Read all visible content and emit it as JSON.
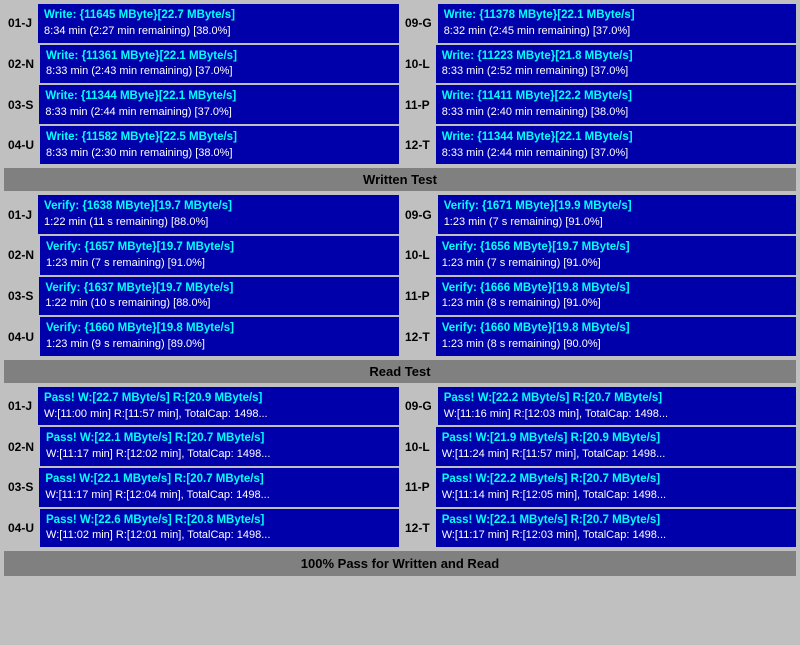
{
  "write_section": {
    "rows_left": [
      {
        "id": "01-J",
        "line1": "Write: {11645 MByte}[22.7 MByte/s]",
        "line2": "8:34 min (2:27 min remaining)  [38.0%]"
      },
      {
        "id": "02-N",
        "line1": "Write: {11361 MByte}[22.1 MByte/s]",
        "line2": "8:33 min (2:43 min remaining)  [37.0%]"
      },
      {
        "id": "03-S",
        "line1": "Write: {11344 MByte}[22.1 MByte/s]",
        "line2": "8:33 min (2:44 min remaining)  [37.0%]"
      },
      {
        "id": "04-U",
        "line1": "Write: {11582 MByte}[22.5 MByte/s]",
        "line2": "8:33 min (2:30 min remaining)  [38.0%]"
      }
    ],
    "rows_right": [
      {
        "id": "09-G",
        "line1": "Write: {11378 MByte}[22.1 MByte/s]",
        "line2": "8:32 min (2:45 min remaining)  [37.0%]"
      },
      {
        "id": "10-L",
        "line1": "Write: {11223 MByte}[21.8 MByte/s]",
        "line2": "8:33 min (2:52 min remaining)  [37.0%]"
      },
      {
        "id": "11-P",
        "line1": "Write: {11411 MByte}[22.2 MByte/s]",
        "line2": "8:33 min (2:40 min remaining)  [38.0%]"
      },
      {
        "id": "12-T",
        "line1": "Write: {11344 MByte}[22.1 MByte/s]",
        "line2": "8:33 min (2:44 min remaining)  [37.0%]"
      }
    ],
    "header": "Written Test"
  },
  "verify_section": {
    "rows_left": [
      {
        "id": "01-J",
        "line1": "Verify: {1638 MByte}[19.7 MByte/s]",
        "line2": "1:22 min (11 s remaining)   [88.0%]"
      },
      {
        "id": "02-N",
        "line1": "Verify: {1657 MByte}[19.7 MByte/s]",
        "line2": "1:23 min (7 s remaining)   [91.0%]"
      },
      {
        "id": "03-S",
        "line1": "Verify: {1637 MByte}[19.7 MByte/s]",
        "line2": "1:22 min (10 s remaining)   [88.0%]"
      },
      {
        "id": "04-U",
        "line1": "Verify: {1660 MByte}[19.8 MByte/s]",
        "line2": "1:23 min (9 s remaining)   [89.0%]"
      }
    ],
    "rows_right": [
      {
        "id": "09-G",
        "line1": "Verify: {1671 MByte}[19.9 MByte/s]",
        "line2": "1:23 min (7 s remaining)   [91.0%]"
      },
      {
        "id": "10-L",
        "line1": "Verify: {1656 MByte}[19.7 MByte/s]",
        "line2": "1:23 min (7 s remaining)   [91.0%]"
      },
      {
        "id": "11-P",
        "line1": "Verify: {1666 MByte}[19.8 MByte/s]",
        "line2": "1:23 min (8 s remaining)   [91.0%]"
      },
      {
        "id": "12-T",
        "line1": "Verify: {1660 MByte}[19.8 MByte/s]",
        "line2": "1:23 min (8 s remaining)   [90.0%]"
      }
    ],
    "header": "Read Test"
  },
  "read_section": {
    "rows_left": [
      {
        "id": "01-J",
        "line1": "Pass! W:[22.7 MByte/s] R:[20.9 MByte/s]",
        "line2": "W:[11:00 min] R:[11:57 min], TotalCap: 1498..."
      },
      {
        "id": "02-N",
        "line1": "Pass! W:[22.1 MByte/s] R:[20.7 MByte/s]",
        "line2": "W:[11:17 min] R:[12:02 min], TotalCap: 1498..."
      },
      {
        "id": "03-S",
        "line1": "Pass! W:[22.1 MByte/s] R:[20.7 MByte/s]",
        "line2": "W:[11:17 min] R:[12:04 min], TotalCap: 1498..."
      },
      {
        "id": "04-U",
        "line1": "Pass! W:[22.6 MByte/s] R:[20.8 MByte/s]",
        "line2": "W:[11:02 min] R:[12:01 min], TotalCap: 1498..."
      }
    ],
    "rows_right": [
      {
        "id": "09-G",
        "line1": "Pass! W:[22.2 MByte/s] R:[20.7 MByte/s]",
        "line2": "W:[11:16 min] R:[12:03 min], TotalCap: 1498..."
      },
      {
        "id": "10-L",
        "line1": "Pass! W:[21.9 MByte/s] R:[20.9 MByte/s]",
        "line2": "W:[11:24 min] R:[11:57 min], TotalCap: 1498..."
      },
      {
        "id": "11-P",
        "line1": "Pass! W:[22.2 MByte/s] R:[20.7 MByte/s]",
        "line2": "W:[11:14 min] R:[12:05 min], TotalCap: 1498..."
      },
      {
        "id": "12-T",
        "line1": "Pass! W:[22.1 MByte/s] R:[20.7 MByte/s]",
        "line2": "W:[11:17 min] R:[12:03 min], TotalCap: 1498..."
      }
    ]
  },
  "status_bar": "100% Pass for Written and Read"
}
